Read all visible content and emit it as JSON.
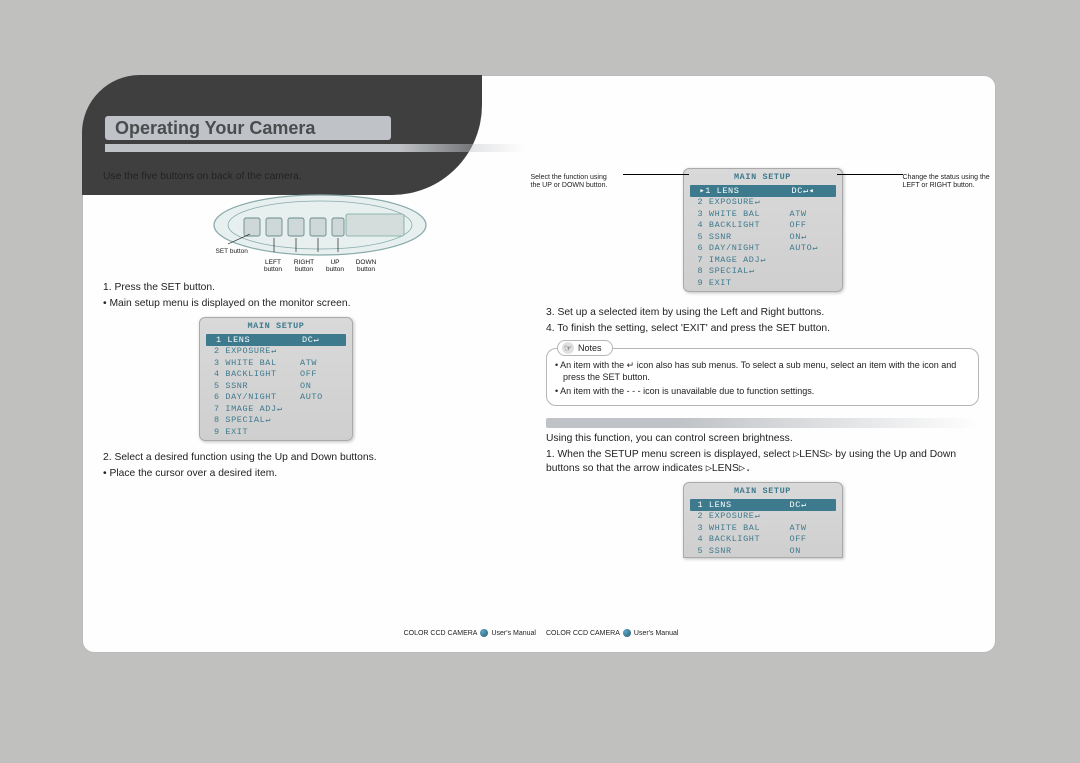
{
  "title": "Operating Your Camera",
  "left": {
    "intro": "Use the five buttons on back of the camera.",
    "set_label": "SET button",
    "button_labels": [
      "LEFT\nbutton",
      "RIGHT\nbutton",
      "UP\nbutton",
      "DOWN\nbutton"
    ],
    "step1": "1. Press the SET button.",
    "step1_sub": "• Main setup menu is displayed on the monitor screen.",
    "osd_title": "MAIN SETUP",
    "osd_rows": [
      {
        "k": "1 LENS",
        "v": "DC↵",
        "sel": true
      },
      {
        "k": "2 EXPOSURE↵",
        "v": ""
      },
      {
        "k": "3 WHITE BAL",
        "v": "ATW"
      },
      {
        "k": "4 BACKLIGHT",
        "v": "OFF"
      },
      {
        "k": "5 SSNR",
        "v": "ON"
      },
      {
        "k": "6 DAY/NIGHT",
        "v": "AUTO"
      },
      {
        "k": "7 IMAGE ADJ↵",
        "v": ""
      },
      {
        "k": "8 SPECIAL↵",
        "v": ""
      },
      {
        "k": "9 EXIT",
        "v": ""
      }
    ],
    "step2": "2. Select a desired function using the Up and Down buttons.",
    "step2_sub": "• Place the cursor over a desired item."
  },
  "right": {
    "anno_left": "Select the function using the UP or DOWN button.",
    "anno_right": "Change the status using the LEFT or RIGHT button.",
    "osd_title": "MAIN SETUP",
    "osd_rows": [
      {
        "k": "▸1 LENS",
        "v": "DC↵◂",
        "sel": true
      },
      {
        "k": "2 EXPOSURE↵",
        "v": ""
      },
      {
        "k": "3 WHITE BAL",
        "v": "ATW"
      },
      {
        "k": "4 BACKLIGHT",
        "v": "OFF"
      },
      {
        "k": "5 SSNR",
        "v": "ON↵"
      },
      {
        "k": "6 DAY/NIGHT",
        "v": "AUTO↵"
      },
      {
        "k": "7 IMAGE ADJ↵",
        "v": ""
      },
      {
        "k": "8 SPECIAL↵",
        "v": ""
      },
      {
        "k": "9 EXIT",
        "v": ""
      }
    ],
    "step3": "3. Set up a selected item by using the Left and Right buttons.",
    "step4": "4. To finish the setting, select 'EXIT' and press the SET button.",
    "notes_label": "Notes",
    "note1": "• An item with the ↵ icon also has sub menus. To select a sub menu, select an item with the icon and press the SET button.",
    "note2": "• An item with the - - - icon is unavailable due to function settings.",
    "section_intro": "Using this function, you can control screen brightness.",
    "section_step1a": "1. When the SETUP menu screen is displayed, select",
    "lens_token1": "LENS",
    "section_step1b": "by using the Up and Down buttons so that the arrow indicates",
    "lens_token2": "LENS",
    "osd2_title": "MAIN SETUP",
    "osd2_rows": [
      {
        "k": "1 LENS",
        "v": "DC↵",
        "sel": true
      },
      {
        "k": "2 EXPOSURE↵",
        "v": ""
      },
      {
        "k": "3 WHITE BAL",
        "v": "ATW"
      },
      {
        "k": "4 BACKLIGHT",
        "v": "OFF"
      },
      {
        "k": "5 SSNR",
        "v": "ON"
      }
    ]
  },
  "footer": {
    "left": "COLOR CCD CAMERA",
    "right": "User's Manual"
  }
}
